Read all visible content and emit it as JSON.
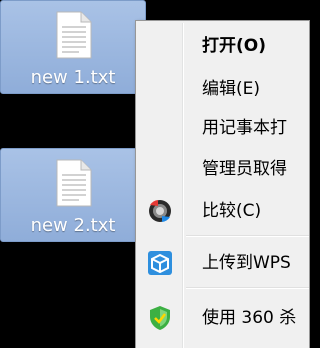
{
  "desktop": {
    "icons": [
      {
        "label": "new 1.txt"
      },
      {
        "label": "new 2.txt"
      }
    ]
  },
  "context_menu": {
    "items": [
      {
        "label": "打开(O)",
        "bold": true
      },
      {
        "label": "编辑(E)"
      },
      {
        "label": "用记事本打"
      },
      {
        "label": "管理员取得"
      },
      {
        "label": "比较(C)",
        "icon": "compare-icon"
      },
      {
        "label": "上传到WPS",
        "icon": "upload-cube-icon"
      },
      {
        "label": "使用 360 杀",
        "icon": "shield-360-icon"
      }
    ]
  },
  "colors": {
    "selection_bg": "#9fb8e0",
    "menu_bg": "#f0f0f0",
    "desktop_bg": "#000000",
    "upload_icon": "#2e8fde",
    "shield_icon": "#3cb043"
  }
}
